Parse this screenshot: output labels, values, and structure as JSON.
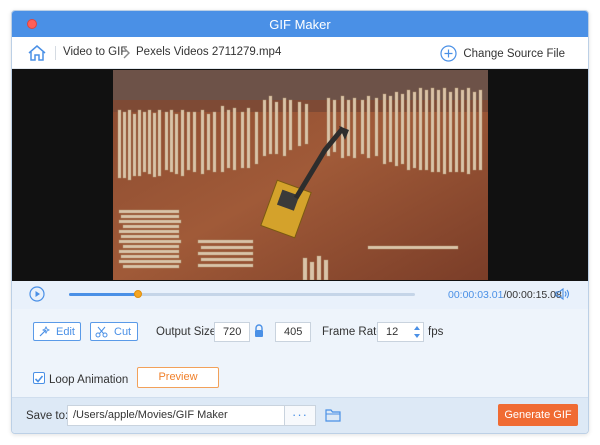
{
  "window": {
    "title": "GIF Maker"
  },
  "nav": {
    "crumb_root": "Video to GIF",
    "crumb_file": "Pexels Videos 2711279.mp4",
    "change_source": "Change Source File"
  },
  "player": {
    "current_time": "00:00:03.01",
    "total_time": "/00:00:15.08",
    "progress": 0.2
  },
  "edit": {
    "edit_label": "Edit",
    "cut_label": "Cut",
    "output_size_label": "Output Size:",
    "width": "720",
    "height": "405",
    "frame_rate_label": "Frame Rate:",
    "frame_rate": "12",
    "fps_label": "fps",
    "loop_label": "Loop Animation",
    "loop_checked": true,
    "preview_label": "Preview"
  },
  "footer": {
    "save_to_label": "Save to:",
    "path": "/Users/apple/Movies/GIF Maker",
    "browse_label": "···",
    "generate_label": "Generate GIF"
  },
  "colors": {
    "accent": "#4a90e6",
    "generate": "#f06b33",
    "preview": "#f0802b",
    "knob": "#f5a623"
  }
}
